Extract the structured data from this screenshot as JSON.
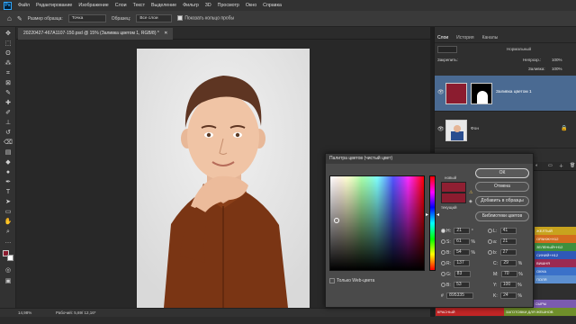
{
  "menubar": {
    "logo": "Ps",
    "items": [
      "Файл",
      "Редактирование",
      "Изображение",
      "Слои",
      "Текст",
      "Выделение",
      "Фильтр",
      "3D",
      "Просмотр",
      "Окно",
      "Справка"
    ]
  },
  "options": {
    "sample_size_label": "Размер образца:",
    "sample_size_value": "Точка",
    "sample_label": "Образец:",
    "sample_value": "Все слои",
    "show_ring_label": "Показать кольцо пробы"
  },
  "document": {
    "tab_title": "20220427-467A1107-150.psd @ 15% (Заливка цветом 1, RGB/8) *"
  },
  "status": {
    "zoom": "14,98%",
    "doc_info": "Рабочий: 5,69/ 12,16*"
  },
  "panel": {
    "tabs": [
      "Слои",
      "История",
      "Каналы"
    ],
    "blend_mode": "Нормальный",
    "opacity_label": "Непрозр.:",
    "opacity_value": "100%",
    "lock_label": "Закрепить:",
    "fill_label": "Заливка:",
    "fill_value": "100%",
    "layers": [
      {
        "name": "Заливка цветом 1"
      },
      {
        "name": "Фон"
      }
    ]
  },
  "swatches": [
    "ЖЕЛТЫЙ",
    "ОРАНЖ+Н12",
    "ЗЕЛЕНЫЙ+Н12",
    "СИНИЙ+Н12",
    "ВИШНЯ",
    "ОКНА",
    "ПОЛЯ",
    "КРАСНЫЙ",
    "НЕСЕДЕЛИМЫЕ СЫРЫ",
    "ЗАГОТОВКИ ДЛЯ ЖЕШНОВ"
  ],
  "picker": {
    "title": "Палитра цветов (чистый цвет)",
    "new_label": "новый",
    "current_label": "текущий",
    "buttons": {
      "ok": "ОК",
      "cancel": "Отмена",
      "add": "Добавить в образцы",
      "libraries": "Библиотеки цветов"
    },
    "web_only_label": "Только Web-цвета",
    "new_color": "#8f1f32",
    "current_color": "#8b1c2f",
    "hsb": {
      "H": "21",
      "S": "61",
      "B": "54",
      "H_unit": "°",
      "S_unit": "%",
      "B_unit": "%"
    },
    "rgb": {
      "R": "137",
      "G": "83",
      "B": "53"
    },
    "lab": {
      "L": "41",
      "a": "21",
      "b": "27"
    },
    "cmyk": {
      "C": "29",
      "M": "70",
      "Y": "100",
      "K": "24"
    },
    "hex": "895335"
  }
}
